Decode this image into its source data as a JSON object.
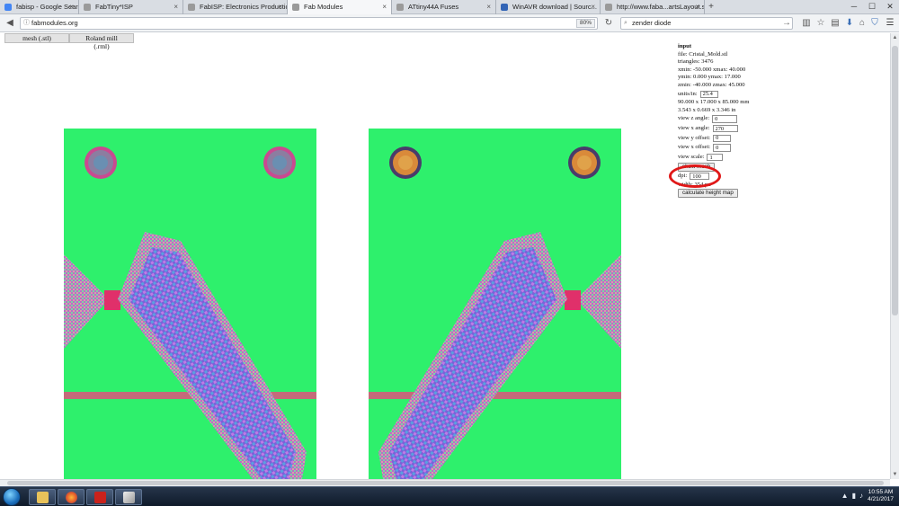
{
  "browser": {
    "tabs": [
      {
        "title": "fabisp - Google Search",
        "favicon_color": "#4285f4",
        "active": false
      },
      {
        "title": "FabTiny*ISP",
        "favicon_color": "#7a7a7a",
        "active": false
      },
      {
        "title": "FabISP: Electronics Production",
        "favicon_color": "#7a7a7a",
        "active": false
      },
      {
        "title": "Fab Modules",
        "favicon_color": "#7a7a7a",
        "active": true
      },
      {
        "title": "ATtiny44A Fuses",
        "favicon_color": "#7a7a7a",
        "active": false
      },
      {
        "title": "WinAVR download | Sourc...",
        "favicon_color": "#3365b6",
        "active": false
      },
      {
        "title": "http://www.faba...artsLayout.svg",
        "favicon_color": "#7a7a7a",
        "active": false
      }
    ],
    "new_tab_symbol": "+",
    "window_controls": {
      "minimize": "─",
      "maximize": "☐",
      "close": "✕"
    },
    "url": "fabmodules.org",
    "zoom": "80%",
    "search_value": "zender diode",
    "toolbar_icons": [
      "reader-icon",
      "library-icon",
      "star-icon",
      "bookmarks-icon",
      "download-icon",
      "home-icon",
      "pocket-icon",
      "menu-icon"
    ]
  },
  "page": {
    "top_buttons": [
      "mesh (.stl)",
      "Roland mill (.rml)"
    ],
    "inputs": {
      "title": "input",
      "file": "file: Cristal_Mold.stl",
      "triangles": "triangles: 3476",
      "xrange": "xmin: -50.000 xmax: 40.000",
      "yrange": "ymin: 0.000 ymax: 17.000",
      "zrange": "zmin: -40.000 zmax: 45.000",
      "units_label": "units/in:",
      "units_value": "25.4",
      "size_mm": "90.000 x 17.000 x 85.000 mm",
      "size_in": "3.543 x 0.669 x 3.346 in",
      "view_z_label": "view z angle:",
      "view_z_value": "0",
      "view_x_label": "view x angle:",
      "view_x_value": "270",
      "view_y_offset_label": "view y offset:",
      "view_y_offset_value": "0",
      "view_x_offset_label": "view x offset:",
      "view_x_offset_value": "0",
      "view_scale_label": "view scale:",
      "view_scale_value": "1",
      "show_mesh_button": "show mesh",
      "dpi_label": "dpi:",
      "dpi_value": "100",
      "width_text": "width: 354 px",
      "calculate_button": "calculate height map"
    },
    "colors": {
      "panel_green": "#2ef06c",
      "annotation_red": "#e01818"
    }
  },
  "taskbar": {
    "time": "10:55 AM",
    "date": "4/21/2017",
    "apps": [
      "explorer",
      "firefox",
      "flash",
      "virtualbox"
    ]
  }
}
